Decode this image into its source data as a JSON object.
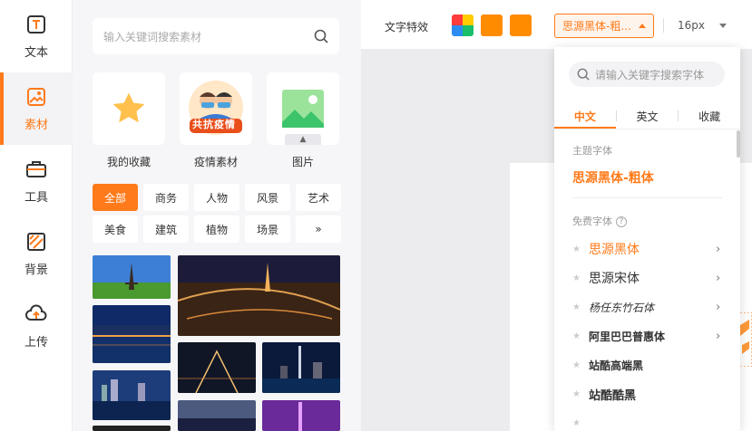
{
  "rail": {
    "items": [
      {
        "label": "文本",
        "icon": "text-icon"
      },
      {
        "label": "素材",
        "icon": "material-icon",
        "active": true
      },
      {
        "label": "工具",
        "icon": "toolbox-icon"
      },
      {
        "label": "背景",
        "icon": "background-icon"
      },
      {
        "label": "上传",
        "icon": "upload-cloud-icon"
      }
    ]
  },
  "panel": {
    "search_placeholder": "输入关键词搜索素材",
    "cards": [
      {
        "label": "我的收藏",
        "icon": "star-icon"
      },
      {
        "label": "疫情素材",
        "badge": "共抗疫情"
      },
      {
        "label": "图片",
        "icon": "image-icon"
      }
    ],
    "chips": [
      "全部",
      "商务",
      "人物",
      "风景",
      "艺术",
      "美食",
      "建筑",
      "植物",
      "场景",
      "»"
    ]
  },
  "toolbar": {
    "effect_label": "文字特效",
    "font_value": "思源黑体-粗...",
    "size_value": "16px",
    "colors": {
      "accent": "#ff7a1a",
      "swatch_orange": "#ff8c00"
    }
  },
  "dropdown": {
    "search_placeholder": "请输入关键字搜索字体",
    "tabs": [
      "中文",
      "英文",
      "收藏"
    ],
    "theme_section": "主题字体",
    "theme_font": "思源黑体-粗体",
    "free_section": "免费字体",
    "fonts": [
      {
        "name": "思源黑体",
        "active": true,
        "arrow": true
      },
      {
        "name": "思源宋体",
        "arrow": true
      },
      {
        "name": "杨任东竹石体",
        "arrow": true
      },
      {
        "name": "阿里巴巴普惠体",
        "arrow": true
      },
      {
        "name": "站酷高端黑",
        "arrow": false
      },
      {
        "name": "站酷酷黑",
        "arrow": false
      }
    ]
  }
}
